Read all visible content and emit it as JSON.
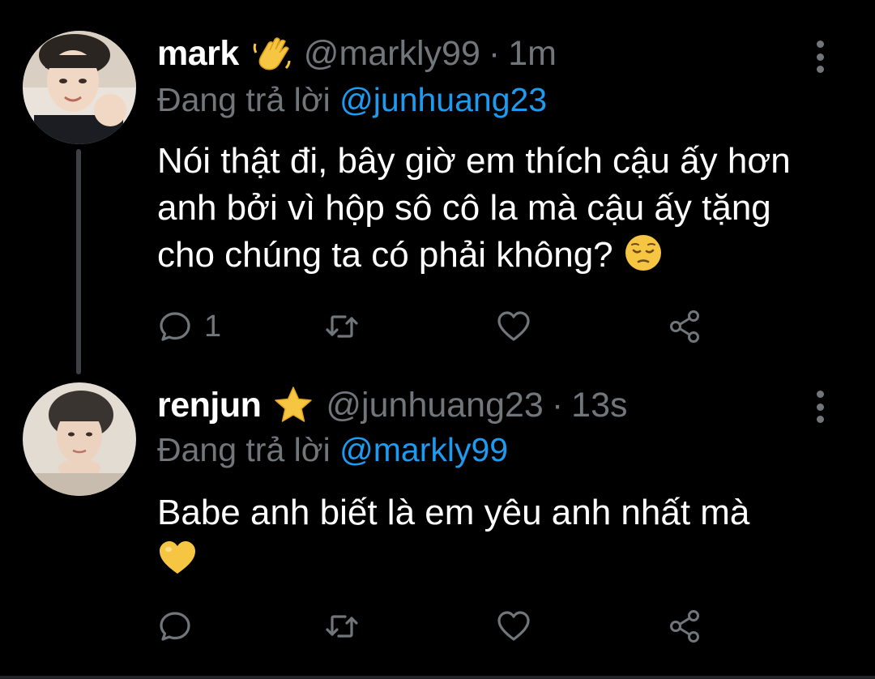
{
  "tweets": [
    {
      "name": "mark",
      "name_emoji": "waving-hand",
      "handle": "@markly99",
      "separator": "·",
      "time": "1m",
      "reply_prefix": "Đang trả lời",
      "reply_to": "@junhuang23",
      "text": "Nói thật đi, bây giờ em thích cậu ấy hơn anh bởi vì hộp sô cô la mà cậu ấy tặng cho chúng ta có phải không?",
      "text_emoji": "pensive-face",
      "reply_count": "1"
    },
    {
      "name": "renjun",
      "name_emoji": "star",
      "handle": "@junhuang23",
      "separator": "·",
      "time": "13s",
      "reply_prefix": "Đang trả lời",
      "reply_to": "@markly99",
      "text": "Babe anh biết là em yêu anh nhất mà",
      "text_emoji": "yellow-heart",
      "reply_count": ""
    }
  ],
  "colors": {
    "background": "#000000",
    "primary_text": "#ffffff",
    "secondary_text": "#71767b",
    "link": "#1d9bf0",
    "thread_line": "#3d4145"
  },
  "icons": {
    "reply": "speech-bubble-icon",
    "retweet": "retweet-icon",
    "like": "heart-outline-icon",
    "share": "share-nodes-icon",
    "more": "vertical-ellipsis-icon"
  }
}
